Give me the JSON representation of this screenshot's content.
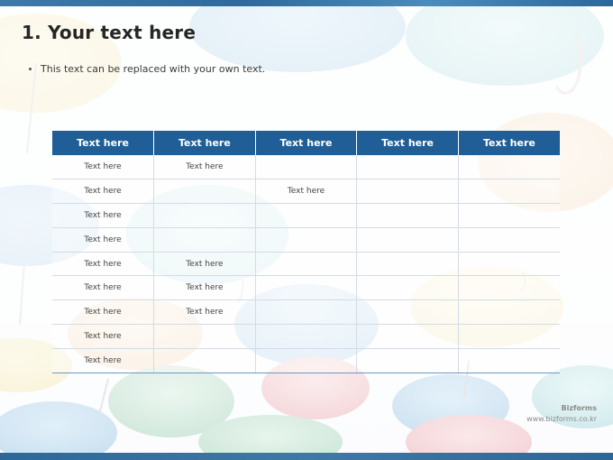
{
  "slide": {
    "title": "1. Your text here",
    "bullet": "This text can be replaced with your own text."
  },
  "table": {
    "headers": [
      "Text here",
      "Text here",
      "Text here",
      "Text here",
      "Text here"
    ],
    "rows": [
      [
        "Text here",
        "Text here",
        "",
        "",
        ""
      ],
      [
        "Text here",
        "",
        "Text here",
        "",
        ""
      ],
      [
        "Text here",
        "",
        "",
        "",
        ""
      ],
      [
        "Text here",
        "",
        "",
        "",
        ""
      ],
      [
        "Text here",
        "Text here",
        "",
        "",
        ""
      ],
      [
        "Text here",
        "Text here",
        "",
        "",
        ""
      ],
      [
        "Text here",
        "Text here",
        "",
        "",
        ""
      ],
      [
        "Text here",
        "",
        "",
        "",
        ""
      ],
      [
        "Text here",
        "",
        "",
        "",
        ""
      ]
    ]
  },
  "footer": {
    "brand": "Bizforms",
    "url": "www.bizforms.co.kr"
  },
  "colors": {
    "header_fill": "#1f5e96",
    "accent_bar": "#3f79a8"
  },
  "icons": {
    "background": "umbrella-icon"
  }
}
